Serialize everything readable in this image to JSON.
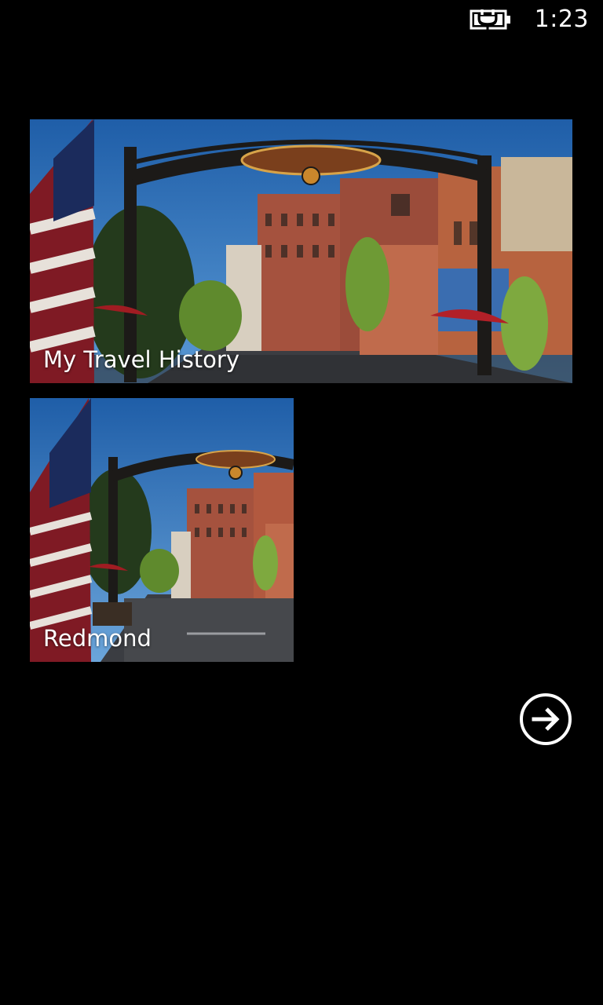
{
  "status_bar": {
    "battery_icon": "battery-charging-icon",
    "time": "1:23"
  },
  "tiles": [
    {
      "label": "My Travel History",
      "image": "redmond-downtown-arch-photo"
    },
    {
      "label": "Redmond",
      "image": "redmond-downtown-arch-photo"
    }
  ],
  "navigation": {
    "next_icon": "arrow-right-circle-icon"
  },
  "colors": {
    "background": "#000000",
    "text": "#ffffff",
    "sky": "#2f6fb3"
  }
}
